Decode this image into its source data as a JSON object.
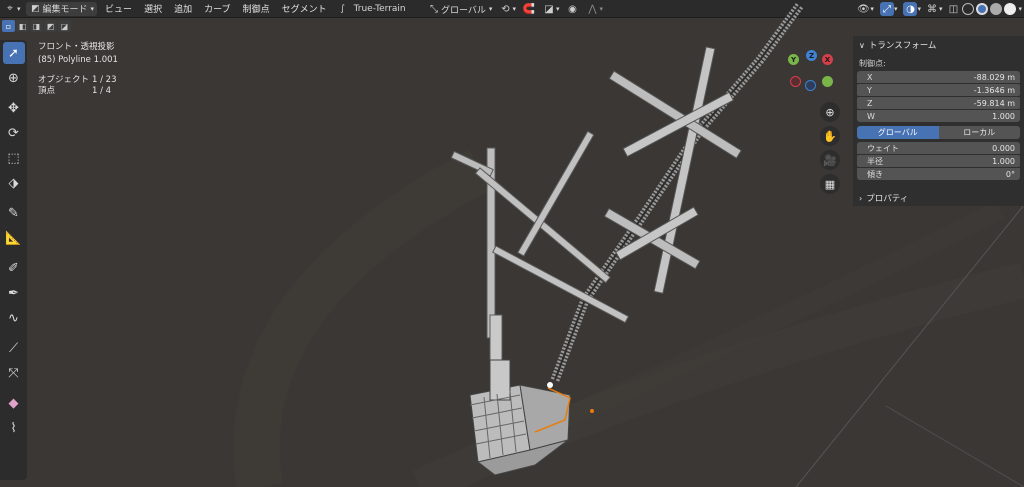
{
  "header": {
    "editor_type_icon": "view3d-icon",
    "mode_label": "編集モード",
    "menu": [
      "ビュー",
      "選択",
      "追加",
      "カーブ",
      "制御点",
      "セグメント"
    ],
    "object_name": "True-Terrain",
    "transform_orientation": "グローバル",
    "pivot_icon": "pivot-icon",
    "snap_icon": "magnet-icon",
    "proportional_icon": "proportional-icon"
  },
  "toolbar": {
    "tools": [
      "select-box",
      "cursor",
      "move",
      "rotate",
      "scale",
      "transform",
      "annotate",
      "measure",
      "draw",
      "pen",
      "curve-pen",
      "tilt",
      "radius",
      "randomize",
      "extrude",
      "shrink"
    ]
  },
  "overlay": {
    "view_name": "フロント・透視投影",
    "active": "(85) Polyline 1.001",
    "objects_label": "オブジェクト",
    "objects_value": "1 / 23",
    "vertices_label": "頂点",
    "vertices_value": "1 / 4"
  },
  "gizmo": {
    "y": "Y",
    "z": "Z",
    "x": "X"
  },
  "npanel": {
    "transform_title": "トランスフォーム",
    "control_point_label": "制御点:",
    "x_label": "X",
    "x_value": "-88.029 m",
    "y_label": "Y",
    "y_value": "-1.3646 m",
    "z_label": "Z",
    "z_value": "-59.814 m",
    "w_label": "W",
    "w_value": "1.000",
    "global_label": "グローバル",
    "local_label": "ローカル",
    "weight_label": "ウェイト",
    "weight_value": "0.000",
    "radius_label": "半径",
    "radius_value": "1.000",
    "tilt_label": "傾き",
    "tilt_value": "0°",
    "properties_title": "プロパティ"
  },
  "colors": {
    "accent": "#4772b3",
    "header_bg": "#2b2b2b",
    "viewport_bg": "#3a3734",
    "axis_x": "#d33f4a",
    "axis_y": "#7ab54a",
    "axis_z": "#3f82d3",
    "selection_orange": "#e87d0d"
  }
}
